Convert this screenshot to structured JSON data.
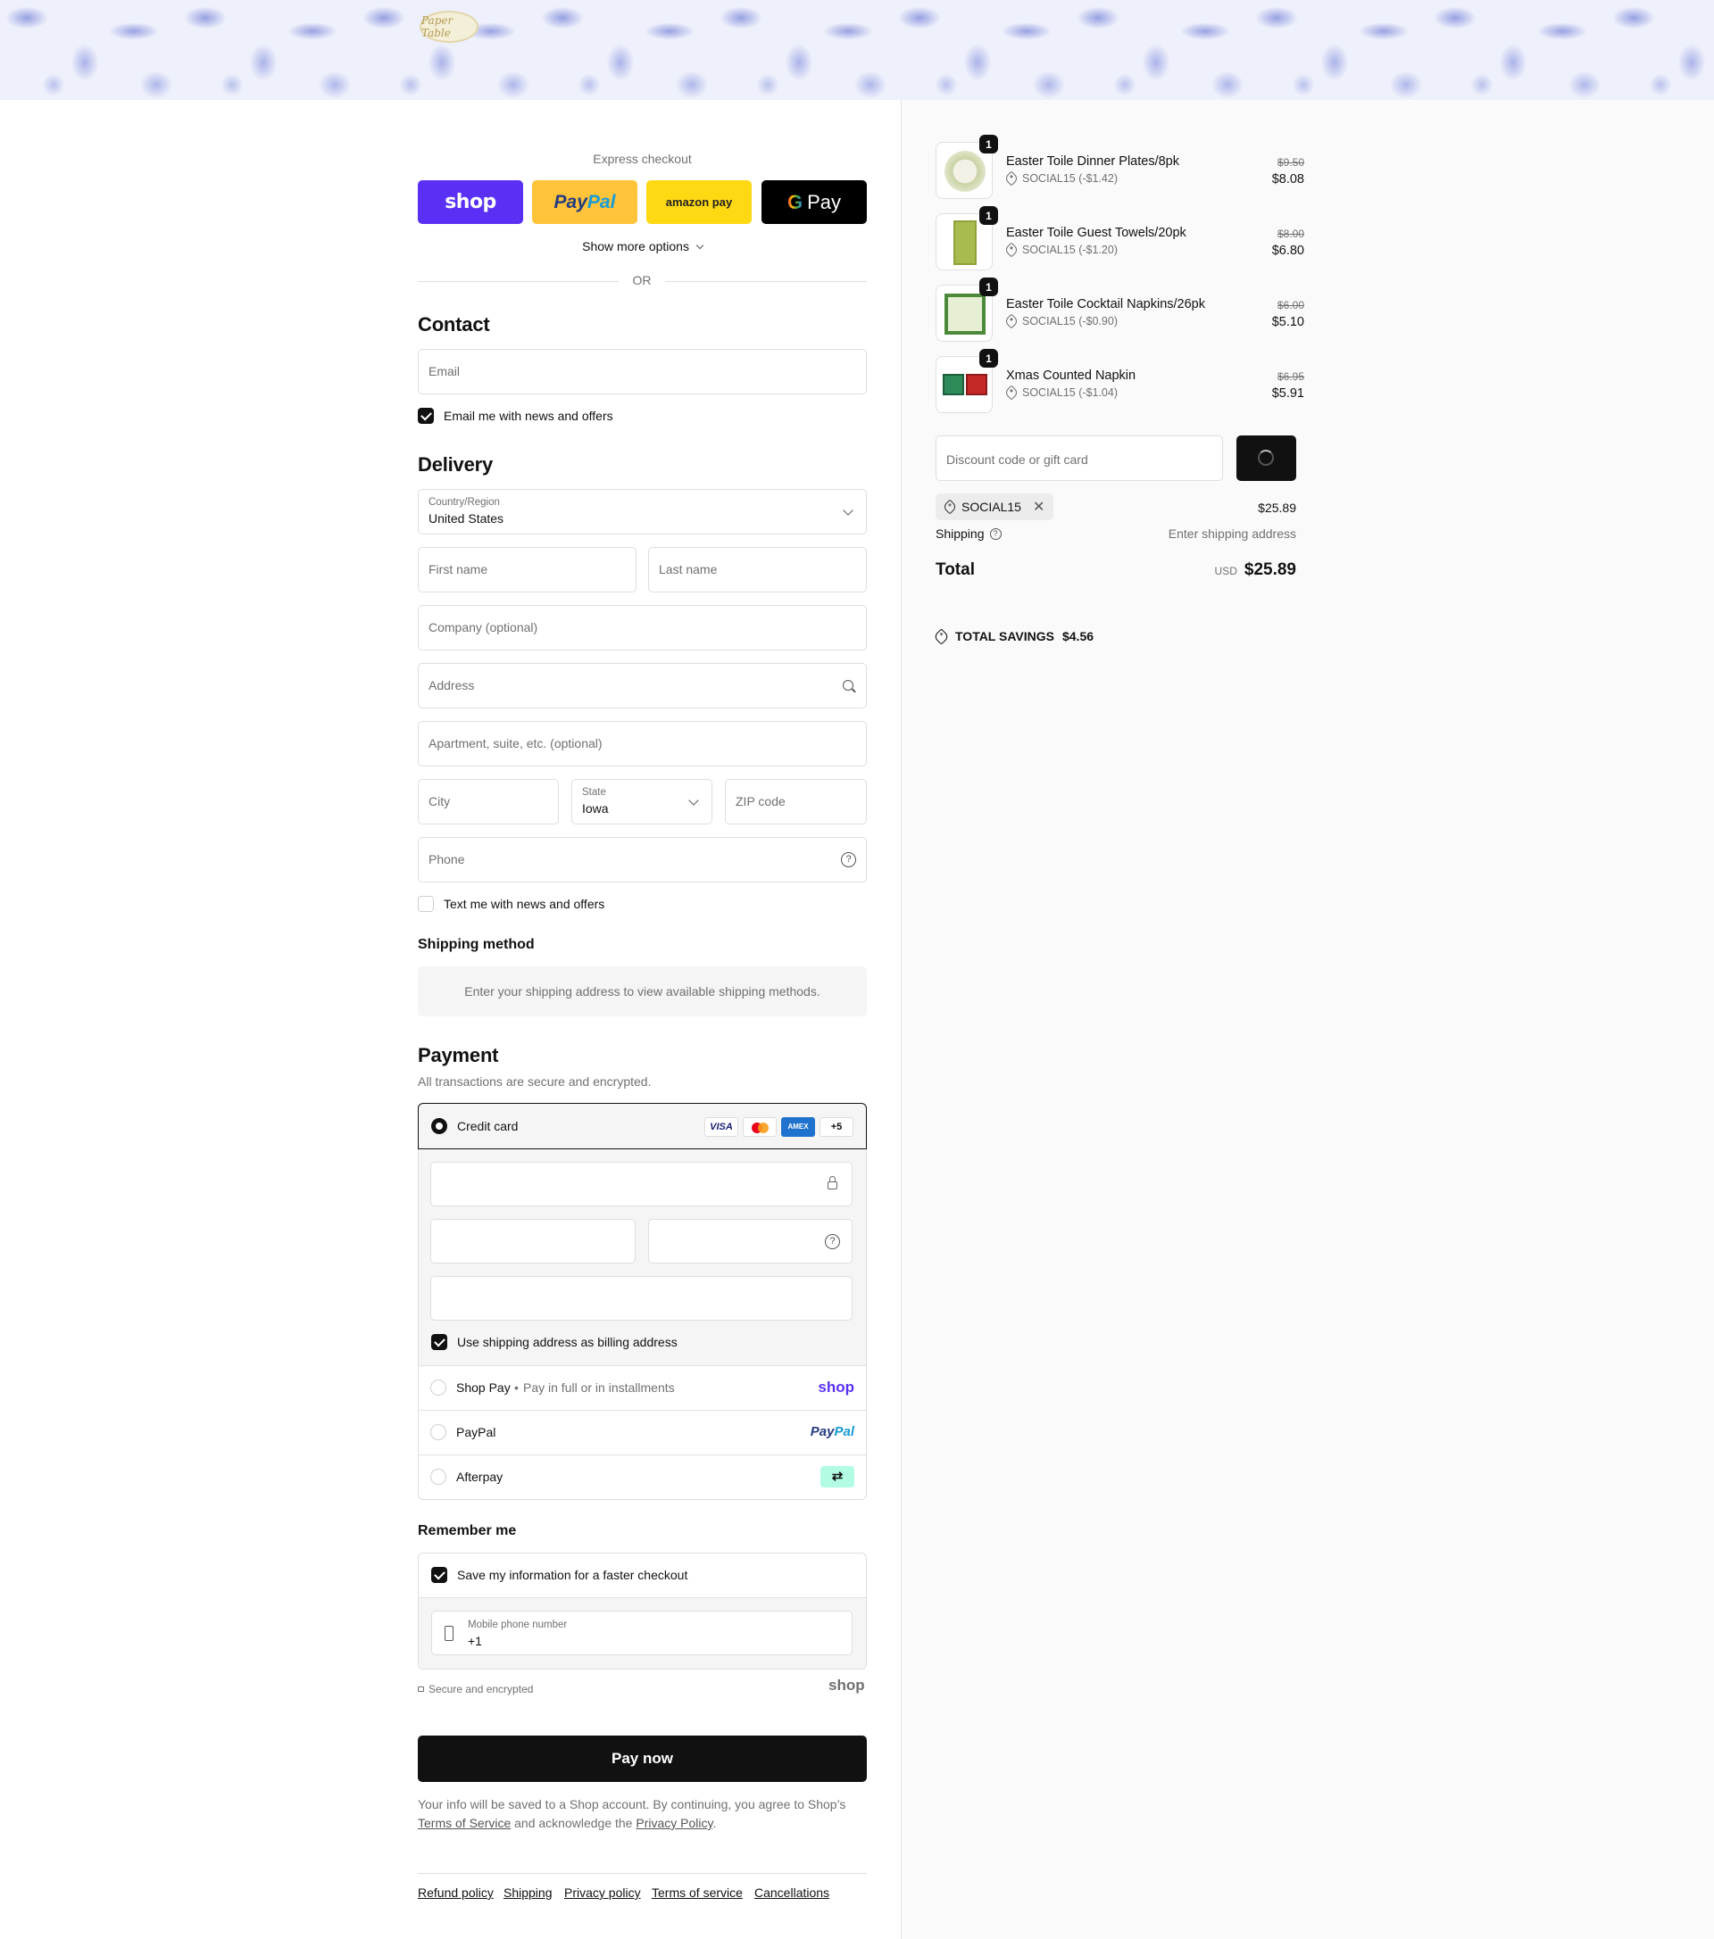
{
  "header": {
    "logo_text": "Paper Table"
  },
  "express": {
    "title": "Express checkout",
    "buttons": [
      "shop",
      "PayPal",
      "amazon pay",
      "G Pay"
    ],
    "more_options": "Show more options",
    "or": "OR"
  },
  "contact": {
    "heading": "Contact",
    "email_placeholder": "Email",
    "email_optin": "Email me with news and offers",
    "email_optin_checked": true
  },
  "delivery": {
    "heading": "Delivery",
    "country_label": "Country/Region",
    "country_value": "United States",
    "first_name": "First name",
    "last_name": "Last name",
    "company": "Company (optional)",
    "address": "Address",
    "apartment": "Apartment, suite, etc. (optional)",
    "city": "City",
    "state_label": "State",
    "state_value": "Iowa",
    "zip": "ZIP code",
    "phone": "Phone",
    "sms_optin": "Text me with news and offers",
    "sms_optin_checked": false
  },
  "shipping_method": {
    "heading": "Shipping method",
    "notice": "Enter your shipping address to view available shipping methods."
  },
  "payment": {
    "heading": "Payment",
    "subtitle": "All transactions are secure and encrypted.",
    "credit_card_label": "Credit card",
    "card_brands": [
      "VISA",
      "Mastercard",
      "AMEX"
    ],
    "more_brands": "+5",
    "billing_same": "Use shipping address as billing address",
    "billing_same_checked": true,
    "shop_pay_label": "Shop Pay",
    "shop_pay_sub": "Pay in full or in installments",
    "shop_pay_logo": "shop",
    "paypal_label": "PayPal",
    "paypal_logo": "PayPal",
    "afterpay_label": "Afterpay"
  },
  "remember": {
    "heading": "Remember me",
    "save_info": "Save my information for a faster checkout",
    "save_info_checked": true,
    "phone_label": "Mobile phone number",
    "phone_value": "+1",
    "secure_text": "Secure and encrypted",
    "shop_logo": "shop"
  },
  "pay_now": "Pay now",
  "legal": {
    "text_before": "Your info will be saved to a Shop account. By continuing, you agree to Shop’s",
    "terms": "Terms of Service",
    "text_mid": "and acknowledge the",
    "privacy": "Privacy Policy",
    "text_end": "."
  },
  "footer_links": [
    "Refund policy",
    "Shipping",
    "Privacy policy",
    "Terms of service",
    "Cancellations"
  ],
  "cart": {
    "items": [
      {
        "name": "Easter Toile Dinner Plates/8pk",
        "qty": "1",
        "discount": "SOCIAL15 (-$1.42)",
        "original": "$9.50",
        "price": "$8.08"
      },
      {
        "name": "Easter Toile Guest Towels/20pk",
        "qty": "1",
        "discount": "SOCIAL15 (-$1.20)",
        "original": "$8.00",
        "price": "$6.80"
      },
      {
        "name": "Easter Toile Cocktail Napkins/26pk",
        "qty": "1",
        "discount": "SOCIAL15 (-$0.90)",
        "original": "$6.00",
        "price": "$5.10"
      },
      {
        "name": "Xmas Counted Napkin",
        "qty": "1",
        "discount": "SOCIAL15 (-$1.04)",
        "original": "$6.95",
        "price": "$5.91"
      }
    ],
    "discount_placeholder": "Discount code or gift card",
    "applied_code": "SOCIAL15",
    "subtotal": "$25.89",
    "shipping_label": "Shipping",
    "shipping_value": "Enter shipping address",
    "total_label": "Total",
    "currency": "USD",
    "total": "$25.89",
    "savings_label": "TOTAL SAVINGS",
    "savings_value": "$4.56"
  },
  "colors": {
    "shop_purple": "#5a31f4",
    "paypal_yellow": "#ffc439",
    "amazon_yellow": "#ffd814",
    "afterpay_mint": "#b2fce4",
    "accent_dark": "#111111"
  }
}
